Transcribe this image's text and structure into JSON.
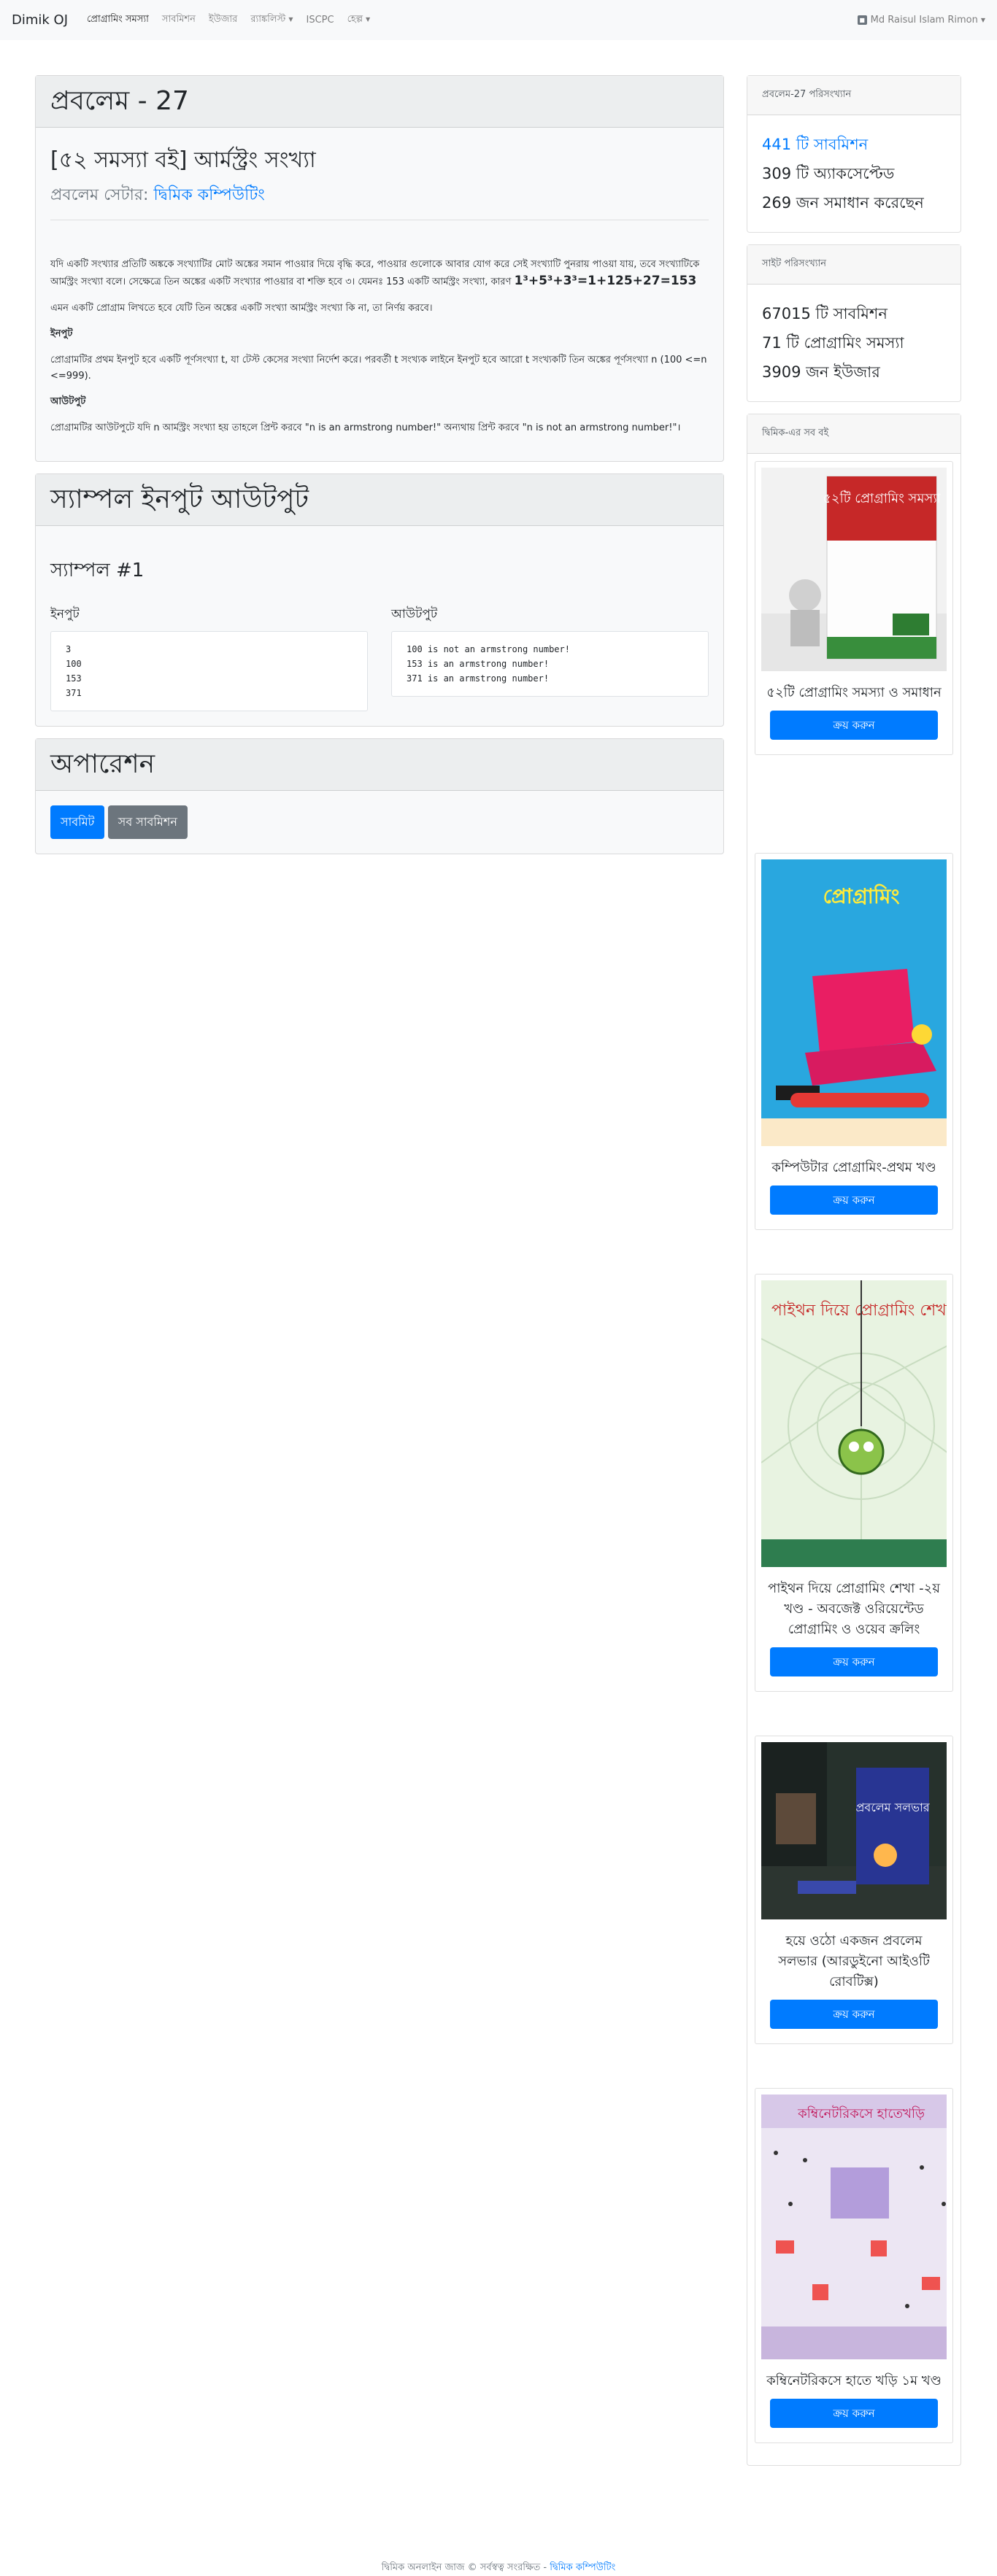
{
  "navbar": {
    "brand": "Dimik OJ",
    "items": [
      {
        "label": "প্রোগ্রামিং সমস্যা",
        "active": true
      },
      {
        "label": "সাবমিশন"
      },
      {
        "label": "ইউজার"
      },
      {
        "label": "র‍্যাঙ্কলিস্ট",
        "dropdown": true
      },
      {
        "label": "ISCPC"
      },
      {
        "label": "হেল্প",
        "dropdown": true
      }
    ],
    "user": "Md Raisul Islam Rimon"
  },
  "problem": {
    "header": "প্রবলেম - 27",
    "title": "[৫২ সমস্যা বই] আর্মস্ট্রং সংখ্যা",
    "setter_label": "প্রবলেম সেটার:",
    "setter_name": "দ্বিমিক কম্পিউটিং",
    "statement_p1": "যদি একটি সংখ্যার প্রতিটি অঙ্ককে সংখ্যাটির মোট অঙ্কের সমান পাওয়ার দিয়ে বৃদ্ধি করে, পাওয়ার গুলোকে আবার যোগ করে সেই সংখ্যাটি পুনরায় পাওয়া যায়, তবে সংখ্যাটিকে আর্মস্ট্রং সংখ্যা বলে। সেক্ষেত্রে তিন অঙ্কের একটি সংখ্যার পাওয়ার বা শক্তি হবে ৩। যেমনঃ 153 একটি আর্মস্ট্রং সংখ্যা, কারণ",
    "formula": "1³+5³+3³=1+125+27=153",
    "statement_p2": "এমন একটি প্রোগ্রাম লিখতে হবে যেটি তিন অঙ্কের একটি সংখ্যা আর্মস্ট্রং সংখ্যা কি না, তা নির্ণয় করবে।",
    "input_heading": "ইনপুট",
    "input_text": "প্রোগ্রামটির প্রথম ইনপুট হবে একটি পূর্ণসংখ্যা t, যা টেস্ট কেসের সংখ্যা নির্দেশ করে। পরবর্তী t সংখ্যক লাইনে ইনপুট হবে আরো t সংখ্যকটি তিন অঙ্কের পূর্ণসংখ্যা n (100 <=n <=999).",
    "output_heading": "আউটপুট",
    "output_text": "প্রোগ্রামটির আউটপুটে যদি n আর্মস্ট্রং সংখ্যা হয় তাহলে প্রিন্ট করবে \"n is an armstrong number!\" অন্যথায় প্রিন্ট করবে \"n is not an armstrong number!\"।"
  },
  "samples": {
    "header": "স্যাম্পল ইনপুট আউটপুট",
    "title": "স্যাম্পল #1",
    "input_label": "ইনপুট",
    "output_label": "আউটপুট",
    "input": "3\n100\n153\n371",
    "output": "100 is not an armstrong number!\n153 is an armstrong number!\n371 is an armstrong number!"
  },
  "operations": {
    "header": "অপারেশন",
    "submit_label": "সাবমিট",
    "all_submissions_label": "সব সাবমিশন"
  },
  "problem_stats": {
    "header": "প্রবলেম-27 পরিসংখ্যান",
    "submissions": "441 টি সাবমিশন",
    "accepted": "309 টি অ্যাকসেপ্টেড",
    "solvers": "269 জন সমাধান করেছেন"
  },
  "site_stats": {
    "header": "সাইট পরিসংখ্যান",
    "submissions": "67015 টি সাবমিশন",
    "problems": "71 টি প্রোগ্রামিং সমস্যা",
    "users": "3909 জন ইউজার"
  },
  "books": {
    "header": "দ্বিমিক-এর সব বই",
    "buy_label": "ক্রয় করুন",
    "items": [
      {
        "title": "৫২টি প্রোগ্রামিং সমস্যা ও সমাধান",
        "cover_text": "৫২টি প্রোগ্রামিং সমস্যা"
      },
      {
        "title": "কম্পিউটার প্রোগ্রামিং-প্রথম খণ্ড",
        "cover_text": "প্রোগ্রামিং"
      },
      {
        "title": "পাইথন দিয়ে প্রোগ্রামিং শেখা -২য় খণ্ড - অবজেক্ট ওরিয়েন্টেড প্রোগ্রামিং ও ওয়েব ক্রলিং",
        "cover_text": "পাইথন দিয়ে প্রোগ্রামিং শেখা"
      },
      {
        "title": "হয়ে ওঠো একজন প্রবলেম সলভার (আরডুইনো আইওটি রোবটিক্স)",
        "cover_text": "প্রবলেম সলভার"
      },
      {
        "title": "কম্বিনেটরিকসে হাতে খড়ি ১ম খণ্ড",
        "cover_text": "কম্বিনেটরিকসে হাতেখড়ি"
      }
    ]
  },
  "footer": {
    "text": "দ্বিমিক অনলাইন জাজ © সর্বস্বত্ব সংরক্ষিত -",
    "link": "দ্বিমিক কম্পিউটিং"
  }
}
